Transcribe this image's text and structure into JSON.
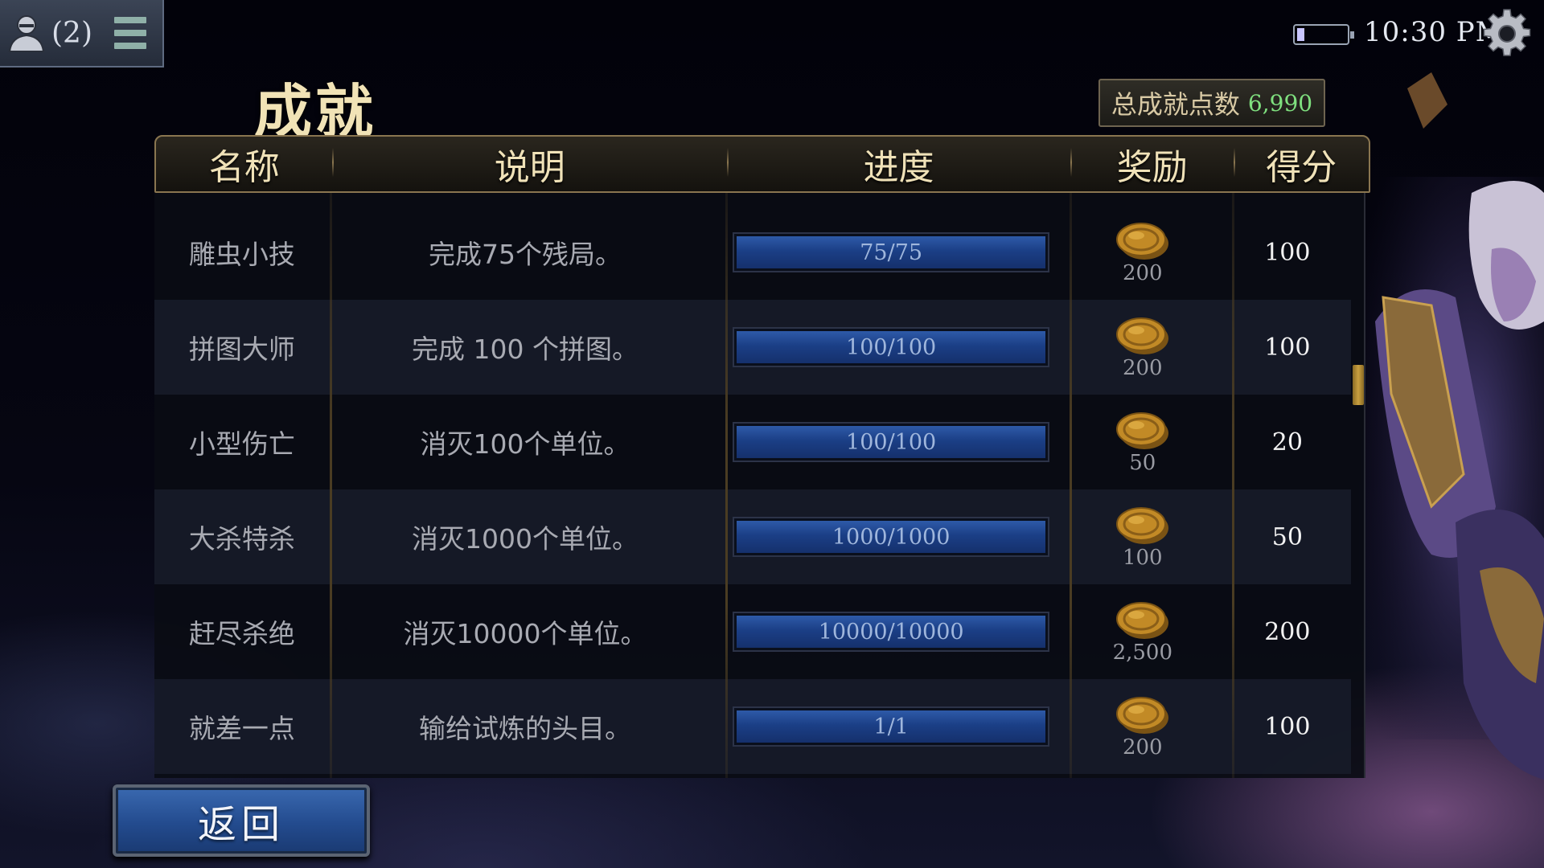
{
  "top_left": {
    "friends_count": "(2)",
    "person_icon": "person-icon",
    "menu_icon": "menu-icon"
  },
  "status": {
    "time": "10:30 PM",
    "battery_level": 0.15,
    "gear_icon": "gear-icon"
  },
  "page": {
    "title": "成就"
  },
  "total": {
    "label": "总成就点数",
    "value": "6,990"
  },
  "table": {
    "headers": {
      "name": "名称",
      "desc": "说明",
      "progress": "进度",
      "reward": "奖励",
      "points": "得分"
    },
    "rows": [
      {
        "name": "雕虫小技",
        "desc": "完成75个残局。",
        "progress_text": "75/75",
        "progress": 1.0,
        "reward": "200",
        "points": "100"
      },
      {
        "name": "拼图大师",
        "desc": "完成 100 个拼图。",
        "progress_text": "100/100",
        "progress": 1.0,
        "reward": "200",
        "points": "100"
      },
      {
        "name": "小型伤亡",
        "desc": "消灭100个单位。",
        "progress_text": "100/100",
        "progress": 1.0,
        "reward": "50",
        "points": "20"
      },
      {
        "name": "大杀特杀",
        "desc": "消灭1000个单位。",
        "progress_text": "1000/1000",
        "progress": 1.0,
        "reward": "100",
        "points": "50"
      },
      {
        "name": "赶尽杀绝",
        "desc": "消灭10000个单位。",
        "progress_text": "10000/10000",
        "progress": 1.0,
        "reward": "2,500",
        "points": "200"
      },
      {
        "name": "就差一点",
        "desc": "输给试炼的头目。",
        "progress_text": "1/1",
        "progress": 1.0,
        "reward": "200",
        "points": "100"
      }
    ],
    "reward_icon": "gold-coin-icon"
  },
  "footer": {
    "back_label": "返回"
  }
}
